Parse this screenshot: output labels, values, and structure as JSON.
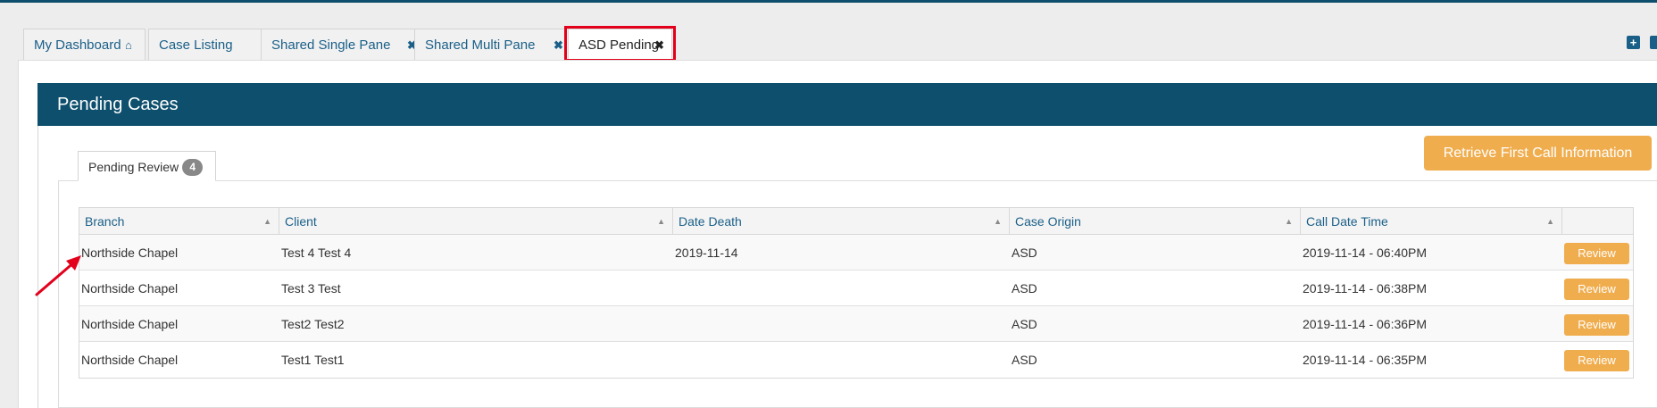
{
  "tabs": [
    {
      "label": "My Dashboard",
      "icon": "home-icon",
      "glyph": "⌂"
    },
    {
      "label": "Case Listing",
      "icon": "close-icon",
      "glyph": "✖"
    },
    {
      "label": "Shared Single Pane",
      "icon": "close-icon",
      "glyph": "✖"
    },
    {
      "label": "Shared Multi Pane",
      "icon": "close-icon",
      "glyph": "✖"
    },
    {
      "label": "ASD Pending",
      "icon": "close-icon",
      "glyph": "✖",
      "active": true
    }
  ],
  "toolbar": {
    "add_icon": "plus-square-icon",
    "add_glyph": "+",
    "edit_icon": "edit-icon",
    "edit_glyph": "✎"
  },
  "panel": {
    "title": "Pending Cases"
  },
  "actions": {
    "retrieve_label": "Retrieve First Call Information"
  },
  "subtab": {
    "label": "Pending Review",
    "count": "4"
  },
  "grid": {
    "columns": [
      "Branch",
      "Client",
      "Date Death",
      "Case Origin",
      "Call Date Time"
    ],
    "sort_glyph": "▲",
    "review_label": "Review",
    "rows": [
      {
        "branch": "Northside Chapel",
        "client": "Test 4 Test 4",
        "date_death": "2019-11-14",
        "case_origin": "ASD",
        "call_date_time": "2019-11-14 - 06:40PM"
      },
      {
        "branch": "Northside Chapel",
        "client": "Test 3 Test",
        "date_death": "",
        "case_origin": "ASD",
        "call_date_time": "2019-11-14 - 06:38PM"
      },
      {
        "branch": "Northside Chapel",
        "client": "Test2 Test2",
        "date_death": "",
        "case_origin": "ASD",
        "call_date_time": "2019-11-14 - 06:36PM"
      },
      {
        "branch": "Northside Chapel",
        "client": "Test1 Test1",
        "date_death": "",
        "case_origin": "ASD",
        "call_date_time": "2019-11-14 - 06:35PM"
      }
    ]
  },
  "colors": {
    "header": "#0e4f6d",
    "accent": "#f0ad4e",
    "link": "#1a5f88",
    "highlight": "#e3001b"
  }
}
